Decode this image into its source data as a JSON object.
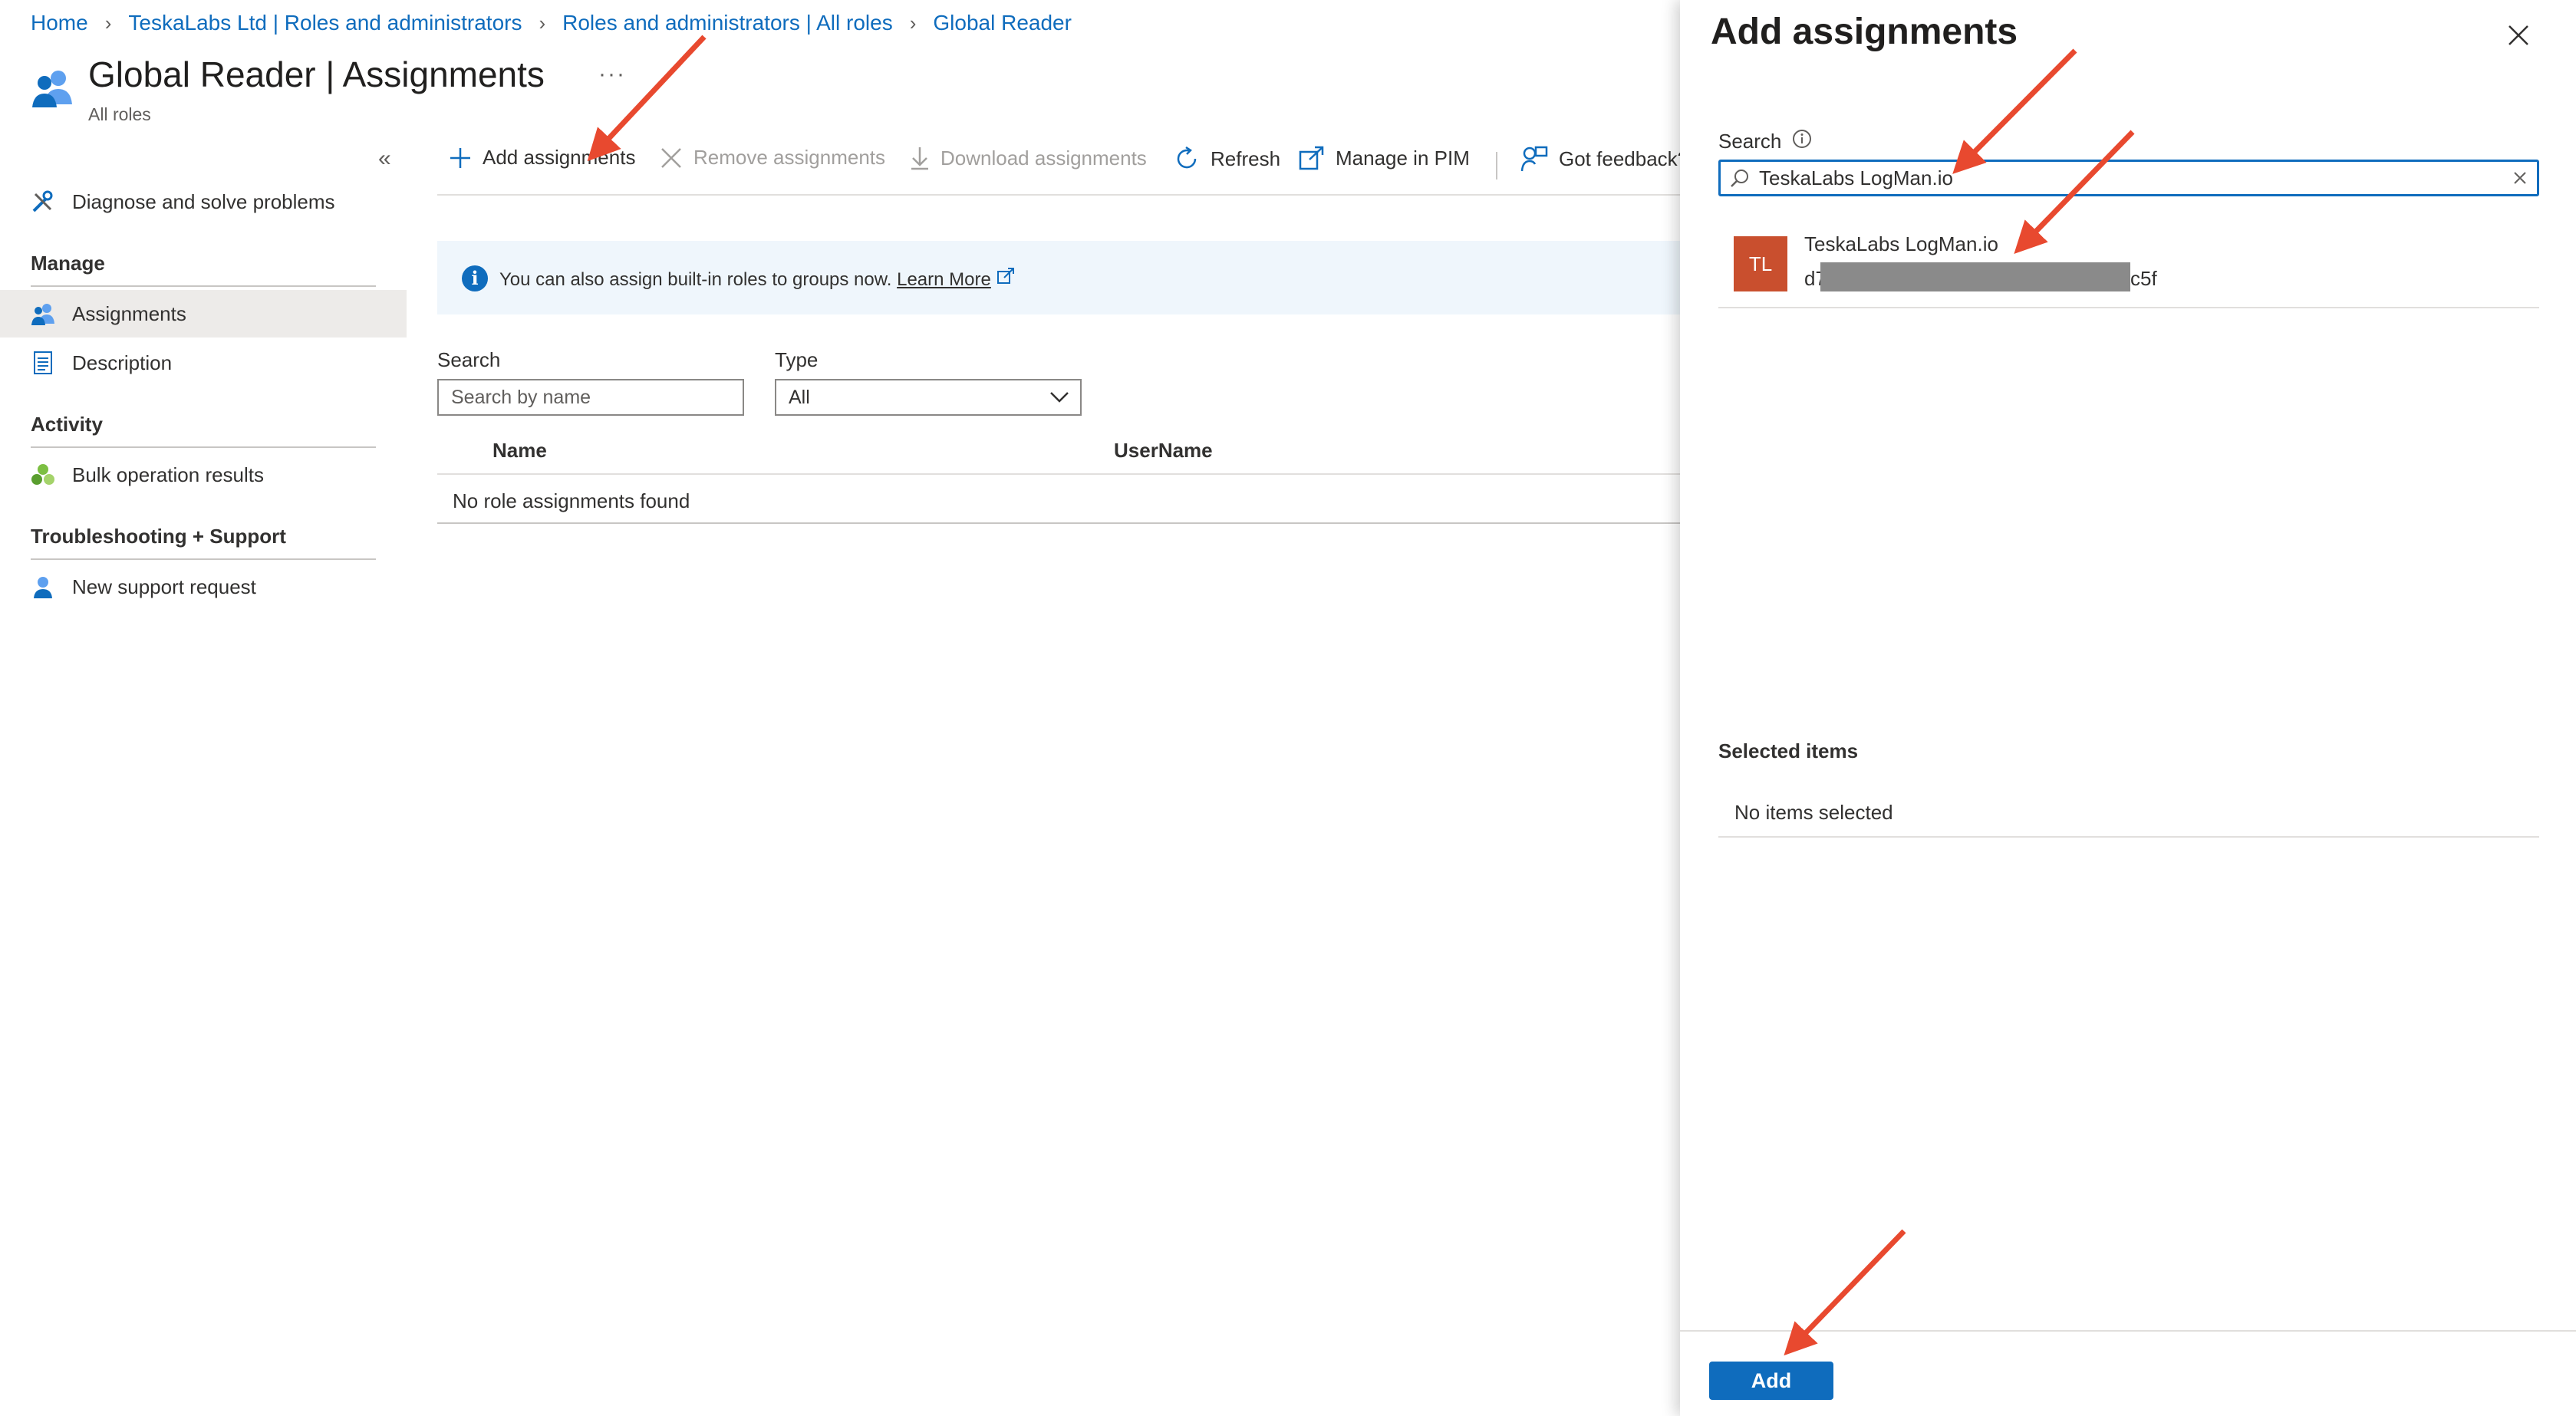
{
  "breadcrumb": [
    "Home",
    "TeskaLabs Ltd | Roles and administrators",
    "Roles and administrators | All roles",
    "Global Reader"
  ],
  "header": {
    "title": "Global Reader | Assignments",
    "subtitle": "All roles",
    "more": "···",
    "collapse": "«"
  },
  "sidebar": {
    "diagnose": "Diagnose and solve problems",
    "manage_heading": "Manage",
    "assignments": "Assignments",
    "description": "Description",
    "activity_heading": "Activity",
    "bulk": "Bulk operation results",
    "troubleshooting_heading": "Troubleshooting + Support",
    "support": "New support request"
  },
  "toolbar": {
    "add": "Add assignments",
    "remove": "Remove assignments",
    "download": "Download assignments",
    "refresh": "Refresh",
    "pim": "Manage in PIM",
    "feedback": "Got feedback?"
  },
  "banner": {
    "text": "You can also assign built-in roles to groups now.",
    "link": "Learn More"
  },
  "filters": {
    "search_label": "Search",
    "search_placeholder": "Search by name",
    "type_label": "Type",
    "type_value": "All"
  },
  "table": {
    "columns": [
      "Name",
      "UserName"
    ],
    "empty": "No role assignments found"
  },
  "panel": {
    "title": "Add assignments",
    "search_label": "Search",
    "search_value": "TeskaLabs LogMan.io",
    "result": {
      "initials": "TL",
      "name": "TeskaLabs LogMan.io",
      "id_prefix": "d7",
      "id_suffix": "c5f"
    },
    "selected_heading": "Selected items",
    "selected_empty": "No items selected",
    "add_button": "Add"
  },
  "colors": {
    "accent": "#0f6cbd",
    "avatar": "#c94f2e",
    "annotation_arrow": "#e8492f"
  }
}
